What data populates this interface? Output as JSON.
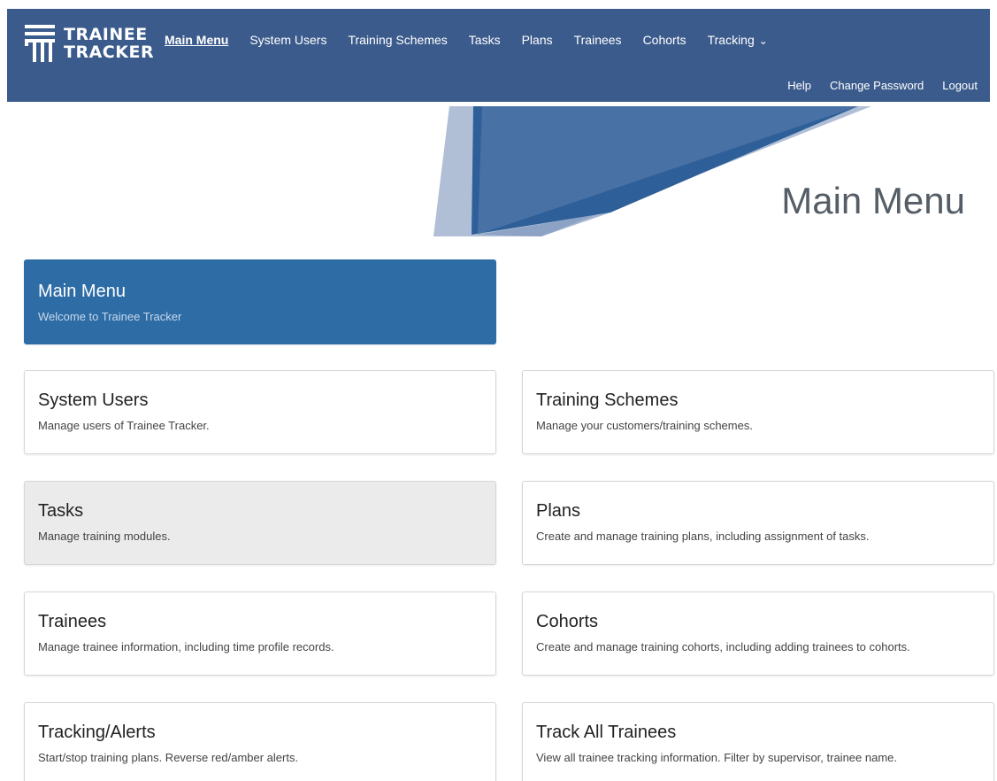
{
  "brand": {
    "line1": "TRAINEE",
    "line2": "TRACKER"
  },
  "nav": {
    "items": [
      {
        "label": "Main Menu",
        "active": true
      },
      {
        "label": "System Users"
      },
      {
        "label": "Training Schemes"
      },
      {
        "label": "Tasks"
      },
      {
        "label": "Plans"
      },
      {
        "label": "Trainees"
      },
      {
        "label": "Cohorts"
      },
      {
        "label": "Tracking",
        "dropdown": true
      }
    ],
    "secondary": [
      {
        "label": "Help"
      },
      {
        "label": "Change Password"
      },
      {
        "label": "Logout"
      }
    ]
  },
  "page": {
    "title": "Main Menu"
  },
  "header_card": {
    "title": "Main Menu",
    "subtitle": "Welcome to Trainee Tracker"
  },
  "cards": [
    {
      "title": "System Users",
      "description": "Manage users of Trainee Tracker."
    },
    {
      "title": "Training Schemes",
      "description": "Manage your customers/training schemes."
    },
    {
      "title": "Tasks",
      "description": "Manage training modules."
    },
    {
      "title": "Plans",
      "description": "Create and manage training plans, including assignment of tasks."
    },
    {
      "title": "Trainees",
      "description": "Manage trainee information, including time profile records."
    },
    {
      "title": "Cohorts",
      "description": "Create and manage training cohorts, including adding trainees to cohorts."
    },
    {
      "title": "Tracking/Alerts",
      "description": "Start/stop training plans. Reverse red/amber alerts."
    },
    {
      "title": "Track All Trainees",
      "description": "View all trainee tracking information. Filter by supervisor, trainee name."
    }
  ],
  "colors": {
    "nav_bg": "#3b5b8c",
    "primary_card": "#2e6ca6",
    "hover_card": "#ebebeb"
  },
  "icons": {
    "brand": "trainee-tracker-logo-icon",
    "dropdown": "chevron-down-icon"
  }
}
